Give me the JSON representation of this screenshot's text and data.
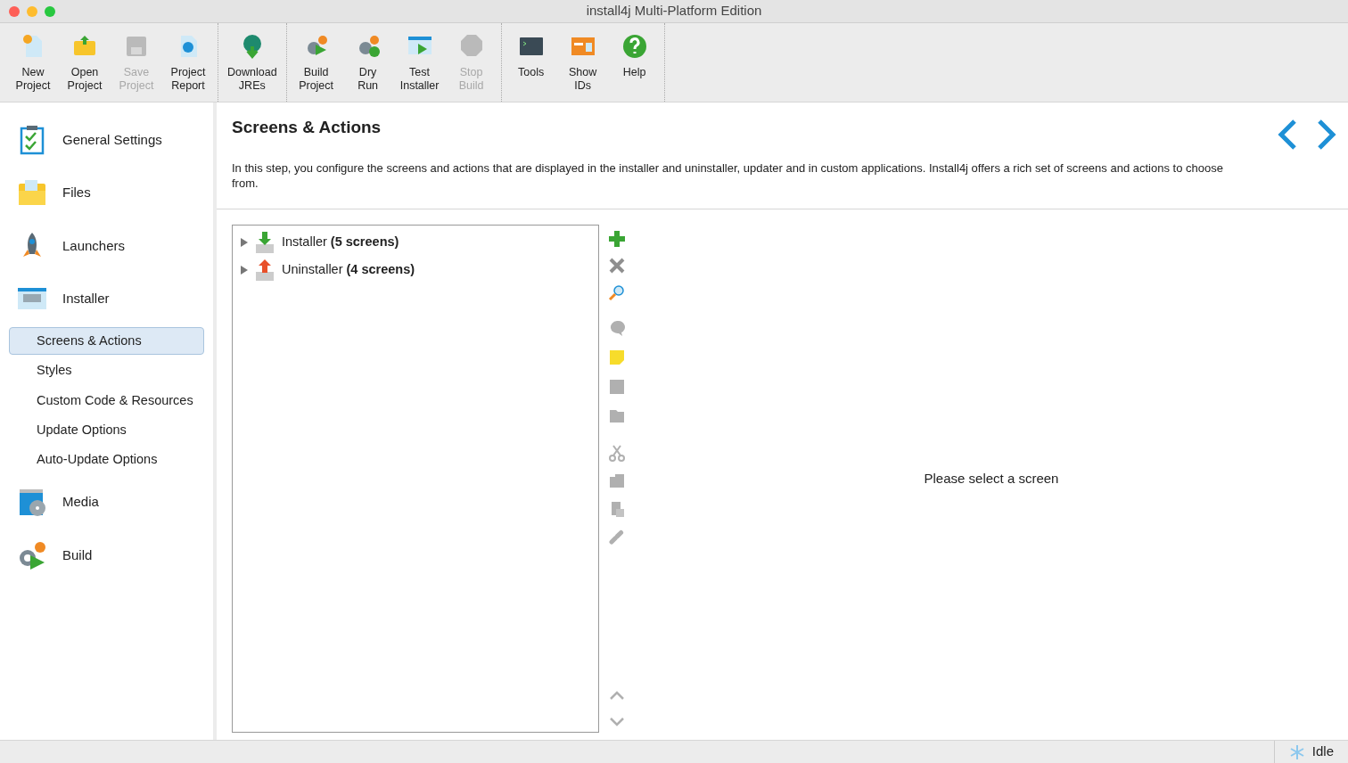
{
  "window": {
    "title": "install4j Multi-Platform Edition"
  },
  "toolbar": {
    "groups": [
      [
        {
          "label": "New Project",
          "disabled": false
        },
        {
          "label": "Open Project",
          "disabled": false
        },
        {
          "label": "Save Project",
          "disabled": true
        },
        {
          "label": "Project Report",
          "disabled": false
        }
      ],
      [
        {
          "label": "Download JREs",
          "disabled": false
        }
      ],
      [
        {
          "label": "Build Project",
          "disabled": false
        },
        {
          "label": "Dry Run",
          "disabled": false
        },
        {
          "label": "Test Installer",
          "disabled": false
        },
        {
          "label": "Stop Build",
          "disabled": true
        }
      ],
      [
        {
          "label": "Tools",
          "disabled": false
        },
        {
          "label": "Show IDs",
          "disabled": false
        },
        {
          "label": "Help",
          "disabled": false
        }
      ]
    ]
  },
  "sidebar": {
    "items": [
      {
        "kind": "section",
        "label": "General Settings",
        "selected": false
      },
      {
        "kind": "section",
        "label": "Files",
        "selected": false
      },
      {
        "kind": "section",
        "label": "Launchers",
        "selected": false
      },
      {
        "kind": "section",
        "label": "Installer",
        "selected": false
      },
      {
        "kind": "sub",
        "label": "Screens & Actions",
        "selected": true
      },
      {
        "kind": "sub",
        "label": "Styles",
        "selected": false
      },
      {
        "kind": "sub",
        "label": "Custom Code & Resources",
        "selected": false
      },
      {
        "kind": "sub",
        "label": "Update Options",
        "selected": false
      },
      {
        "kind": "sub",
        "label": "Auto-Update Options",
        "selected": false
      },
      {
        "kind": "section",
        "label": "Media",
        "selected": false
      },
      {
        "kind": "section",
        "label": "Build",
        "selected": false
      }
    ]
  },
  "page": {
    "title": "Screens & Actions",
    "description": "In this step, you configure the screens and actions that are displayed in the installer and uninstaller, updater and in custom applications. Install4j offers a rich set of screens and actions to choose from."
  },
  "tree": {
    "nodes": [
      {
        "label": "Installer **(5 screens)**",
        "expanded": false
      },
      {
        "label": "Uninstaller **(4 screens)**",
        "expanded": false
      }
    ]
  },
  "tree_tools": [
    {
      "disabled": false
    },
    {
      "disabled": false
    },
    {
      "disabled": false
    },
    {
      "disabled": true
    },
    {
      "disabled": false
    },
    {
      "disabled": true
    },
    {
      "disabled": true
    },
    {
      "disabled": true
    },
    {
      "disabled": true
    },
    {
      "disabled": true
    },
    {
      "disabled": true
    },
    {
      "disabled": true
    },
    {
      "disabled": true
    }
  ],
  "detail": {
    "message": "Please select a screen"
  },
  "status_bar": {
    "status": "Idle"
  }
}
